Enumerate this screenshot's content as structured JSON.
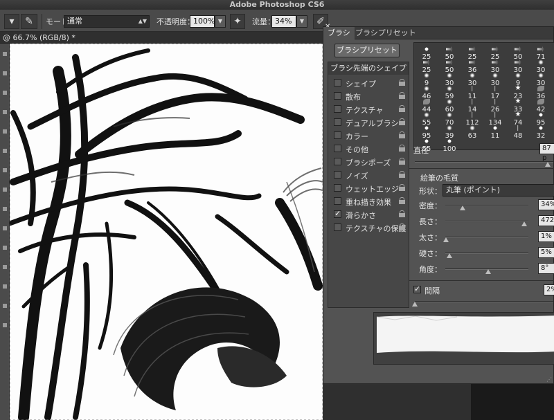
{
  "window": {
    "title": "Adobe Photoshop CS6"
  },
  "options_bar": {
    "mode_label": "モード：",
    "mode_value": "通常",
    "opacity_label": "不透明度：",
    "opacity_value": "100%",
    "flow_label": "流量：",
    "flow_value": "34%"
  },
  "document": {
    "tab_label": "@ 66.7% (RGB/8) *"
  },
  "brush_panel": {
    "tabs": [
      "ブラシ",
      "ブラシプリセット"
    ],
    "preset_button": "ブラシプリセット",
    "list_header": "ブラシ先端のシェイプ",
    "options": [
      {
        "label": "シェイプ",
        "checked": false
      },
      {
        "label": "散布",
        "checked": false
      },
      {
        "label": "テクスチャ",
        "checked": false
      },
      {
        "label": "デュアルブラシ",
        "checked": false
      },
      {
        "label": "カラー",
        "checked": false
      },
      {
        "label": "その他",
        "checked": false
      },
      {
        "label": "ブラシポーズ",
        "checked": false
      },
      {
        "label": "ノイズ",
        "checked": false
      },
      {
        "label": "ウェットエッジ",
        "checked": false
      },
      {
        "label": "重ね描き効果",
        "checked": false
      },
      {
        "label": "滑らかさ",
        "checked": true
      },
      {
        "label": "テクスチャの保護",
        "checked": false
      }
    ],
    "brush_tips": [
      {
        "size": "25",
        "shape": "dot"
      },
      {
        "size": "50",
        "shape": "arrow"
      },
      {
        "size": "25",
        "shape": "arrow"
      },
      {
        "size": "25",
        "shape": "arrow"
      },
      {
        "size": "50",
        "shape": "arrow"
      },
      {
        "size": "71",
        "shape": "arrow"
      },
      {
        "size": "25",
        "shape": "arrow"
      },
      {
        "size": "50",
        "shape": "arrow"
      },
      {
        "size": "36",
        "shape": "arrow"
      },
      {
        "size": "30",
        "shape": "arrow"
      },
      {
        "size": "30",
        "shape": "arrow"
      },
      {
        "size": "30",
        "shape": "splat"
      },
      {
        "size": "9",
        "shape": "splat"
      },
      {
        "size": "30",
        "shape": "splat"
      },
      {
        "size": "30",
        "shape": "splat"
      },
      {
        "size": "30",
        "shape": "splat"
      },
      {
        "size": "9",
        "shape": "splat"
      },
      {
        "size": "30",
        "shape": "splat"
      },
      {
        "size": "46",
        "shape": "splat"
      },
      {
        "size": "59",
        "shape": "splat"
      },
      {
        "size": "11",
        "shape": "grass"
      },
      {
        "size": "17",
        "shape": "grass"
      },
      {
        "size": "23",
        "shape": "star"
      },
      {
        "size": "36",
        "shape": "leaf"
      },
      {
        "size": "44",
        "shape": "leaf"
      },
      {
        "size": "60",
        "shape": "splat"
      },
      {
        "size": "14",
        "shape": "grass"
      },
      {
        "size": "26",
        "shape": "grass"
      },
      {
        "size": "33",
        "shape": "star"
      },
      {
        "size": "42",
        "shape": "leaf"
      },
      {
        "size": "55",
        "shape": "splat"
      },
      {
        "size": "70",
        "shape": "splat"
      },
      {
        "size": "112",
        "shape": "grass"
      },
      {
        "size": "134",
        "shape": "grass"
      },
      {
        "size": "74",
        "shape": "star"
      },
      {
        "size": "95",
        "shape": "dot"
      },
      {
        "size": "95",
        "shape": "dot"
      },
      {
        "size": "39",
        "shape": "splat"
      },
      {
        "size": "63",
        "shape": "splat"
      },
      {
        "size": "11",
        "shape": "dot"
      },
      {
        "size": "48",
        "shape": "grass"
      },
      {
        "size": "32",
        "shape": "dot"
      },
      {
        "size": "55",
        "shape": "dot"
      },
      {
        "size": "100",
        "shape": "dot"
      }
    ],
    "diameter_label": "直径",
    "diameter_value": "87 p",
    "bristle_section": "絵筆の毛質",
    "shape_label": "形状：",
    "shape_value": "丸筆 (ポイント)",
    "params": [
      {
        "label": "密度：",
        "value": "34%",
        "pos": 0.21
      },
      {
        "label": "長さ：",
        "value": "472",
        "pos": 0.95
      },
      {
        "label": "太さ：",
        "value": "1%",
        "pos": 0.01
      },
      {
        "label": "硬さ：",
        "value": "5%",
        "pos": 0.05
      },
      {
        "label": "角度：",
        "value": "8°",
        "pos": 0.52
      }
    ],
    "spacing_label": "間隔",
    "spacing_checked": true,
    "spacing_value": "2%"
  }
}
